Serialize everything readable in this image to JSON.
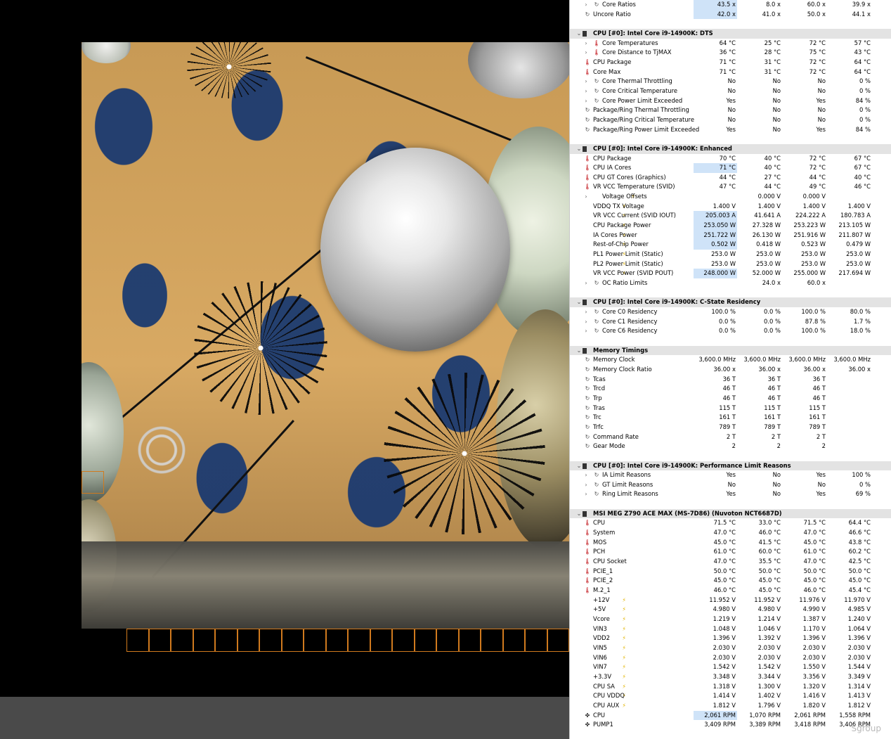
{
  "viewport": {
    "watermark": "Sgroup"
  },
  "hwinfo": {
    "rows": [
      {
        "type": "item",
        "expander": true,
        "icon": "clock",
        "label": "Core Ratios",
        "values": [
          "43.5 x",
          "8.0 x",
          "60.0 x",
          "39.9 x"
        ],
        "hl": [
          0
        ]
      },
      {
        "type": "item",
        "expander": false,
        "icon": "clock",
        "label": "Uncore Ratio",
        "values": [
          "42.0 x",
          "41.0 x",
          "50.0 x",
          "44.1 x"
        ],
        "hl": [
          0
        ]
      },
      {
        "type": "blank"
      },
      {
        "type": "header",
        "label": "CPU [#0]: Intel Core i9-14900K: DTS"
      },
      {
        "type": "item",
        "expander": true,
        "icon": "thermo",
        "label": "Core Temperatures",
        "values": [
          "64 °C",
          "25 °C",
          "72 °C",
          "57 °C"
        ]
      },
      {
        "type": "item",
        "expander": true,
        "icon": "thermo",
        "label": "Core Distance to TjMAX",
        "values": [
          "36 °C",
          "28 °C",
          "75 °C",
          "43 °C"
        ]
      },
      {
        "type": "item",
        "expander": false,
        "icon": "thermo",
        "label": "CPU Package",
        "values": [
          "71 °C",
          "31 °C",
          "72 °C",
          "64 °C"
        ]
      },
      {
        "type": "item",
        "expander": false,
        "icon": "thermo",
        "label": "Core Max",
        "values": [
          "71 °C",
          "31 °C",
          "72 °C",
          "64 °C"
        ]
      },
      {
        "type": "item",
        "expander": true,
        "icon": "clock",
        "label": "Core Thermal Throttling",
        "values": [
          "No",
          "No",
          "No",
          "0 %"
        ]
      },
      {
        "type": "item",
        "expander": true,
        "icon": "clock",
        "label": "Core Critical Temperature",
        "values": [
          "No",
          "No",
          "No",
          "0 %"
        ]
      },
      {
        "type": "item",
        "expander": true,
        "icon": "clock",
        "label": "Core Power Limit Exceeded",
        "values": [
          "Yes",
          "No",
          "Yes",
          "84 %"
        ]
      },
      {
        "type": "item",
        "expander": false,
        "icon": "clock",
        "label": "Package/Ring Thermal Throttling",
        "values": [
          "No",
          "No",
          "No",
          "0 %"
        ]
      },
      {
        "type": "item",
        "expander": false,
        "icon": "clock",
        "label": "Package/Ring Critical Temperature",
        "values": [
          "No",
          "No",
          "No",
          "0 %"
        ]
      },
      {
        "type": "item",
        "expander": false,
        "icon": "clock",
        "label": "Package/Ring Power Limit Exceeded",
        "values": [
          "Yes",
          "No",
          "Yes",
          "84 %"
        ]
      },
      {
        "type": "blank"
      },
      {
        "type": "header",
        "label": "CPU [#0]: Intel Core i9-14900K: Enhanced"
      },
      {
        "type": "item",
        "expander": false,
        "icon": "thermo",
        "label": "CPU Package",
        "values": [
          "70 °C",
          "40 °C",
          "72 °C",
          "67 °C"
        ]
      },
      {
        "type": "item",
        "expander": false,
        "icon": "thermo",
        "label": "CPU IA Cores",
        "values": [
          "71 °C",
          "40 °C",
          "72 °C",
          "67 °C"
        ],
        "hl": [
          0
        ]
      },
      {
        "type": "item",
        "expander": false,
        "icon": "thermo",
        "label": "CPU GT Cores (Graphics)",
        "values": [
          "44 °C",
          "27 °C",
          "44 °C",
          "40 °C"
        ]
      },
      {
        "type": "item",
        "expander": false,
        "icon": "thermo",
        "label": "VR VCC Temperature (SVID)",
        "values": [
          "47 °C",
          "44 °C",
          "49 °C",
          "46 °C"
        ]
      },
      {
        "type": "item",
        "expander": true,
        "icon": "volt",
        "label": "Voltage Offsets",
        "values": [
          "",
          "0.000 V",
          "0.000 V",
          ""
        ]
      },
      {
        "type": "item",
        "expander": false,
        "icon": "volt",
        "label": "VDDQ TX Voltage",
        "values": [
          "1.400 V",
          "1.400 V",
          "1.400 V",
          "1.400 V"
        ]
      },
      {
        "type": "item",
        "expander": false,
        "icon": "volt",
        "label": "VR VCC Current (SVID IOUT)",
        "values": [
          "205.003 A",
          "41.641 A",
          "224.222 A",
          "180.783 A"
        ],
        "hl": [
          0
        ]
      },
      {
        "type": "item",
        "expander": false,
        "icon": "volt",
        "label": "CPU Package Power",
        "values": [
          "253.050 W",
          "27.328 W",
          "253.223 W",
          "213.105 W"
        ],
        "hl": [
          0
        ]
      },
      {
        "type": "item",
        "expander": false,
        "icon": "volt",
        "label": "IA Cores Power",
        "values": [
          "251.722 W",
          "26.130 W",
          "251.916 W",
          "211.807 W"
        ],
        "hl": [
          0
        ]
      },
      {
        "type": "item",
        "expander": false,
        "icon": "volt",
        "label": "Rest-of-Chip Power",
        "values": [
          "0.502 W",
          "0.418 W",
          "0.523 W",
          "0.479 W"
        ],
        "hl": [
          0
        ]
      },
      {
        "type": "item",
        "expander": false,
        "icon": "volt",
        "label": "PL1 Power Limit (Static)",
        "values": [
          "253.0 W",
          "253.0 W",
          "253.0 W",
          "253.0 W"
        ]
      },
      {
        "type": "item",
        "expander": false,
        "icon": "volt",
        "label": "PL2 Power Limit (Static)",
        "values": [
          "253.0 W",
          "253.0 W",
          "253.0 W",
          "253.0 W"
        ]
      },
      {
        "type": "item",
        "expander": false,
        "icon": "volt",
        "label": "VR VCC Power (SVID POUT)",
        "values": [
          "248.000 W",
          "52.000 W",
          "255.000 W",
          "217.694 W"
        ],
        "hl": [
          0
        ]
      },
      {
        "type": "item",
        "expander": true,
        "icon": "clock",
        "label": "OC Ratio Limits",
        "values": [
          "",
          "24.0 x",
          "60.0 x",
          ""
        ]
      },
      {
        "type": "blank"
      },
      {
        "type": "header",
        "label": "CPU [#0]: Intel Core i9-14900K: C-State Residency"
      },
      {
        "type": "item",
        "expander": true,
        "icon": "clock",
        "label": "Core C0 Residency",
        "values": [
          "100.0 %",
          "0.0 %",
          "100.0 %",
          "80.0 %"
        ]
      },
      {
        "type": "item",
        "expander": true,
        "icon": "clock",
        "label": "Core C1 Residency",
        "values": [
          "0.0 %",
          "0.0 %",
          "87.8 %",
          "1.7 %"
        ]
      },
      {
        "type": "item",
        "expander": true,
        "icon": "clock",
        "label": "Core C6 Residency",
        "values": [
          "0.0 %",
          "0.0 %",
          "100.0 %",
          "18.0 %"
        ]
      },
      {
        "type": "blank"
      },
      {
        "type": "header",
        "label": "Memory Timings"
      },
      {
        "type": "item",
        "expander": false,
        "icon": "clock",
        "label": "Memory Clock",
        "values": [
          "3,600.0 MHz",
          "3,600.0 MHz",
          "3,600.0 MHz",
          "3,600.0 MHz"
        ]
      },
      {
        "type": "item",
        "expander": false,
        "icon": "clock",
        "label": "Memory Clock Ratio",
        "values": [
          "36.00 x",
          "36.00 x",
          "36.00 x",
          "36.00 x"
        ]
      },
      {
        "type": "item",
        "expander": false,
        "icon": "clock",
        "label": "Tcas",
        "values": [
          "36 T",
          "36 T",
          "36 T",
          ""
        ]
      },
      {
        "type": "item",
        "expander": false,
        "icon": "clock",
        "label": "Trcd",
        "values": [
          "46 T",
          "46 T",
          "46 T",
          ""
        ]
      },
      {
        "type": "item",
        "expander": false,
        "icon": "clock",
        "label": "Trp",
        "values": [
          "46 T",
          "46 T",
          "46 T",
          ""
        ]
      },
      {
        "type": "item",
        "expander": false,
        "icon": "clock",
        "label": "Tras",
        "values": [
          "115 T",
          "115 T",
          "115 T",
          ""
        ]
      },
      {
        "type": "item",
        "expander": false,
        "icon": "clock",
        "label": "Trc",
        "values": [
          "161 T",
          "161 T",
          "161 T",
          ""
        ]
      },
      {
        "type": "item",
        "expander": false,
        "icon": "clock",
        "label": "Trfc",
        "values": [
          "789 T",
          "789 T",
          "789 T",
          ""
        ]
      },
      {
        "type": "item",
        "expander": false,
        "icon": "clock",
        "label": "Command Rate",
        "values": [
          "2 T",
          "2 T",
          "2 T",
          ""
        ]
      },
      {
        "type": "item",
        "expander": false,
        "icon": "clock",
        "label": "Gear Mode",
        "values": [
          "2",
          "2",
          "2",
          ""
        ]
      },
      {
        "type": "blank"
      },
      {
        "type": "header",
        "label": "CPU [#0]: Intel Core i9-14900K: Performance Limit Reasons"
      },
      {
        "type": "item",
        "expander": true,
        "icon": "clock",
        "label": "IA Limit Reasons",
        "values": [
          "Yes",
          "No",
          "Yes",
          "100 %"
        ]
      },
      {
        "type": "item",
        "expander": true,
        "icon": "clock",
        "label": "GT Limit Reasons",
        "values": [
          "No",
          "No",
          "No",
          "0 %"
        ]
      },
      {
        "type": "item",
        "expander": true,
        "icon": "clock",
        "label": "Ring Limit Reasons",
        "values": [
          "Yes",
          "No",
          "Yes",
          "69 %"
        ]
      },
      {
        "type": "blank"
      },
      {
        "type": "header",
        "label": "MSI MEG Z790 ACE MAX (MS-7D86) (Nuvoton NCT6687D)"
      },
      {
        "type": "item",
        "expander": false,
        "icon": "thermo",
        "label": "CPU",
        "values": [
          "71.5 °C",
          "33.0 °C",
          "71.5 °C",
          "64.4 °C"
        ]
      },
      {
        "type": "item",
        "expander": false,
        "icon": "thermo",
        "label": "System",
        "values": [
          "47.0 °C",
          "46.0 °C",
          "47.0 °C",
          "46.6 °C"
        ]
      },
      {
        "type": "item",
        "expander": false,
        "icon": "thermo",
        "label": "MOS",
        "values": [
          "45.0 °C",
          "41.5 °C",
          "45.0 °C",
          "43.8 °C"
        ]
      },
      {
        "type": "item",
        "expander": false,
        "icon": "thermo",
        "label": "PCH",
        "values": [
          "61.0 °C",
          "60.0 °C",
          "61.0 °C",
          "60.2 °C"
        ]
      },
      {
        "type": "item",
        "expander": false,
        "icon": "thermo",
        "label": "CPU Socket",
        "values": [
          "47.0 °C",
          "35.5 °C",
          "47.0 °C",
          "42.5 °C"
        ]
      },
      {
        "type": "item",
        "expander": false,
        "icon": "thermo",
        "label": "PCIE_1",
        "values": [
          "50.0 °C",
          "50.0 °C",
          "50.0 °C",
          "50.0 °C"
        ]
      },
      {
        "type": "item",
        "expander": false,
        "icon": "thermo",
        "label": "PCIE_2",
        "values": [
          "45.0 °C",
          "45.0 °C",
          "45.0 °C",
          "45.0 °C"
        ]
      },
      {
        "type": "item",
        "expander": false,
        "icon": "thermo",
        "label": "M.2_1",
        "values": [
          "46.0 °C",
          "45.0 °C",
          "46.0 °C",
          "45.4 °C"
        ]
      },
      {
        "type": "item",
        "expander": false,
        "icon": "volt",
        "label": "+12V",
        "values": [
          "11.952 V",
          "11.952 V",
          "11.976 V",
          "11.970 V"
        ]
      },
      {
        "type": "item",
        "expander": false,
        "icon": "volt",
        "label": "+5V",
        "values": [
          "4.980 V",
          "4.980 V",
          "4.990 V",
          "4.985 V"
        ]
      },
      {
        "type": "item",
        "expander": false,
        "icon": "volt",
        "label": "Vcore",
        "values": [
          "1.219 V",
          "1.214 V",
          "1.387 V",
          "1.240 V"
        ]
      },
      {
        "type": "item",
        "expander": false,
        "icon": "volt",
        "label": "VIN3",
        "values": [
          "1.048 V",
          "1.046 V",
          "1.170 V",
          "1.064 V"
        ]
      },
      {
        "type": "item",
        "expander": false,
        "icon": "volt",
        "label": "VDD2",
        "values": [
          "1.396 V",
          "1.392 V",
          "1.396 V",
          "1.396 V"
        ]
      },
      {
        "type": "item",
        "expander": false,
        "icon": "volt",
        "label": "VIN5",
        "values": [
          "2.030 V",
          "2.030 V",
          "2.030 V",
          "2.030 V"
        ]
      },
      {
        "type": "item",
        "expander": false,
        "icon": "volt",
        "label": "VIN6",
        "values": [
          "2.030 V",
          "2.030 V",
          "2.030 V",
          "2.030 V"
        ]
      },
      {
        "type": "item",
        "expander": false,
        "icon": "volt",
        "label": "VIN7",
        "values": [
          "1.542 V",
          "1.542 V",
          "1.550 V",
          "1.544 V"
        ]
      },
      {
        "type": "item",
        "expander": false,
        "icon": "volt",
        "label": "+3.3V",
        "values": [
          "3.348 V",
          "3.344 V",
          "3.356 V",
          "3.349 V"
        ]
      },
      {
        "type": "item",
        "expander": false,
        "icon": "volt",
        "label": "CPU SA",
        "values": [
          "1.318 V",
          "1.300 V",
          "1.320 V",
          "1.314 V"
        ]
      },
      {
        "type": "item",
        "expander": false,
        "icon": "volt",
        "label": "CPU VDDQ",
        "values": [
          "1.414 V",
          "1.402 V",
          "1.416 V",
          "1.413 V"
        ]
      },
      {
        "type": "item",
        "expander": false,
        "icon": "volt",
        "label": "CPU AUX",
        "values": [
          "1.812 V",
          "1.796 V",
          "1.820 V",
          "1.812 V"
        ]
      },
      {
        "type": "item",
        "expander": false,
        "icon": "fan",
        "label": "CPU",
        "values": [
          "2,061 RPM",
          "1,070 RPM",
          "2,061 RPM",
          "1,558 RPM"
        ],
        "hl": [
          0
        ]
      },
      {
        "type": "item",
        "expander": false,
        "icon": "fan",
        "label": "PUMP1",
        "values": [
          "3,409 RPM",
          "3,389 RPM",
          "3,418 RPM",
          "3,406 RPM"
        ]
      }
    ]
  },
  "icons": {
    "clock": "↻",
    "thermo": "🌡",
    "volt": "⚡",
    "fan": "✤",
    "chip": "chip-icon",
    "expander": "›",
    "collapse": "⌄"
  },
  "colors": {
    "highlight": "#cfe3f8",
    "header_bg": "#e3e3e3",
    "thermo": "#c2161c",
    "volt": "#e2b400",
    "tile_border": "#d07a1e"
  }
}
